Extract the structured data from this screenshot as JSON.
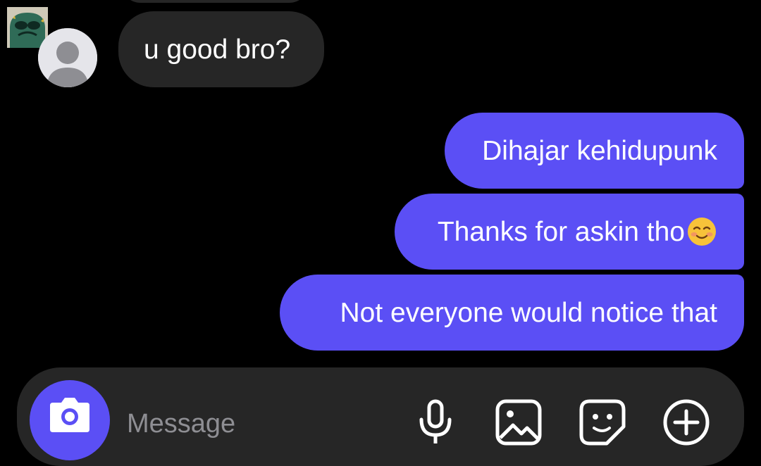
{
  "conversation": {
    "incoming": [
      {
        "text": "u good bro?"
      }
    ],
    "outgoing": [
      {
        "text": "Dihajar kehidupunk"
      },
      {
        "text": "Thanks for askin tho",
        "emoji": "smiling-face-icon"
      },
      {
        "text": "Not everyone would notice that"
      }
    ]
  },
  "composer": {
    "placeholder": "Message",
    "value": "",
    "icons": [
      "camera-icon",
      "microphone-icon",
      "gallery-icon",
      "sticker-icon",
      "plus-icon"
    ]
  },
  "colors": {
    "background": "#000000",
    "incoming_bubble": "#262626",
    "outgoing_bubble": "#5b4ff5",
    "accent": "#5b4ff5",
    "text": "#ffffff",
    "placeholder": "#8e8e93"
  }
}
